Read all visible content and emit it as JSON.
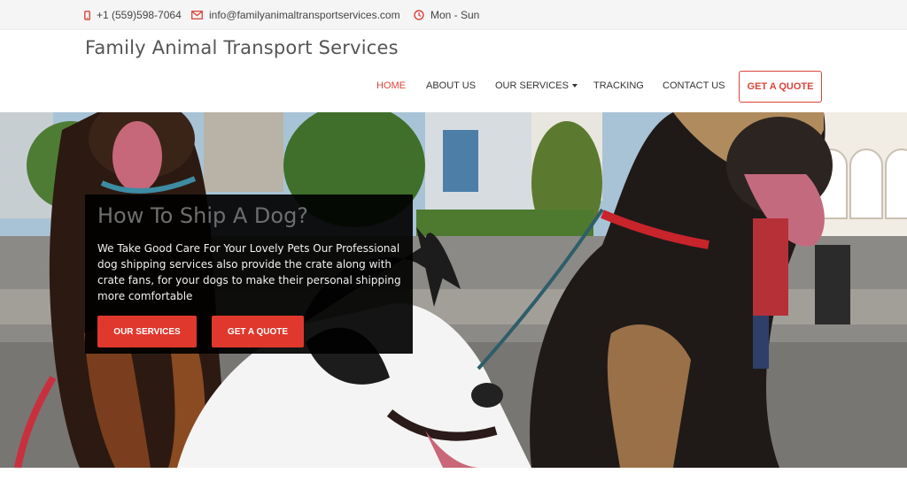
{
  "topbar": {
    "phone": "+1 (559)598-7064",
    "email": "info@familyanimaltransportservices.com",
    "hours": "Mon - Sun",
    "icons": {
      "phone": "phone-icon",
      "email": "envelope-icon",
      "hours": "clock-icon"
    },
    "icon_color": "#d9443a"
  },
  "header": {
    "brand": "Family Animal Transport Services",
    "nav": {
      "home": "HOME",
      "about": "ABOUT US",
      "services": "OUR SERVICES",
      "tracking": "TRACKING",
      "contact": "CONTACT US"
    },
    "quote_button": "GET A QUOTE"
  },
  "hero": {
    "title": "How To Ship A Dog?",
    "text": "We Take Good Care For Your Lovely Pets Our Professional dog shipping services also provide the crate along with crate fans, for your dogs to make their personal shipping more comfortable",
    "services_button": "OUR SERVICES",
    "quote_button": "GET A QUOTE"
  },
  "colors": {
    "accent": "#d9443a",
    "button": "#e0382d",
    "overlay": "#000000"
  }
}
